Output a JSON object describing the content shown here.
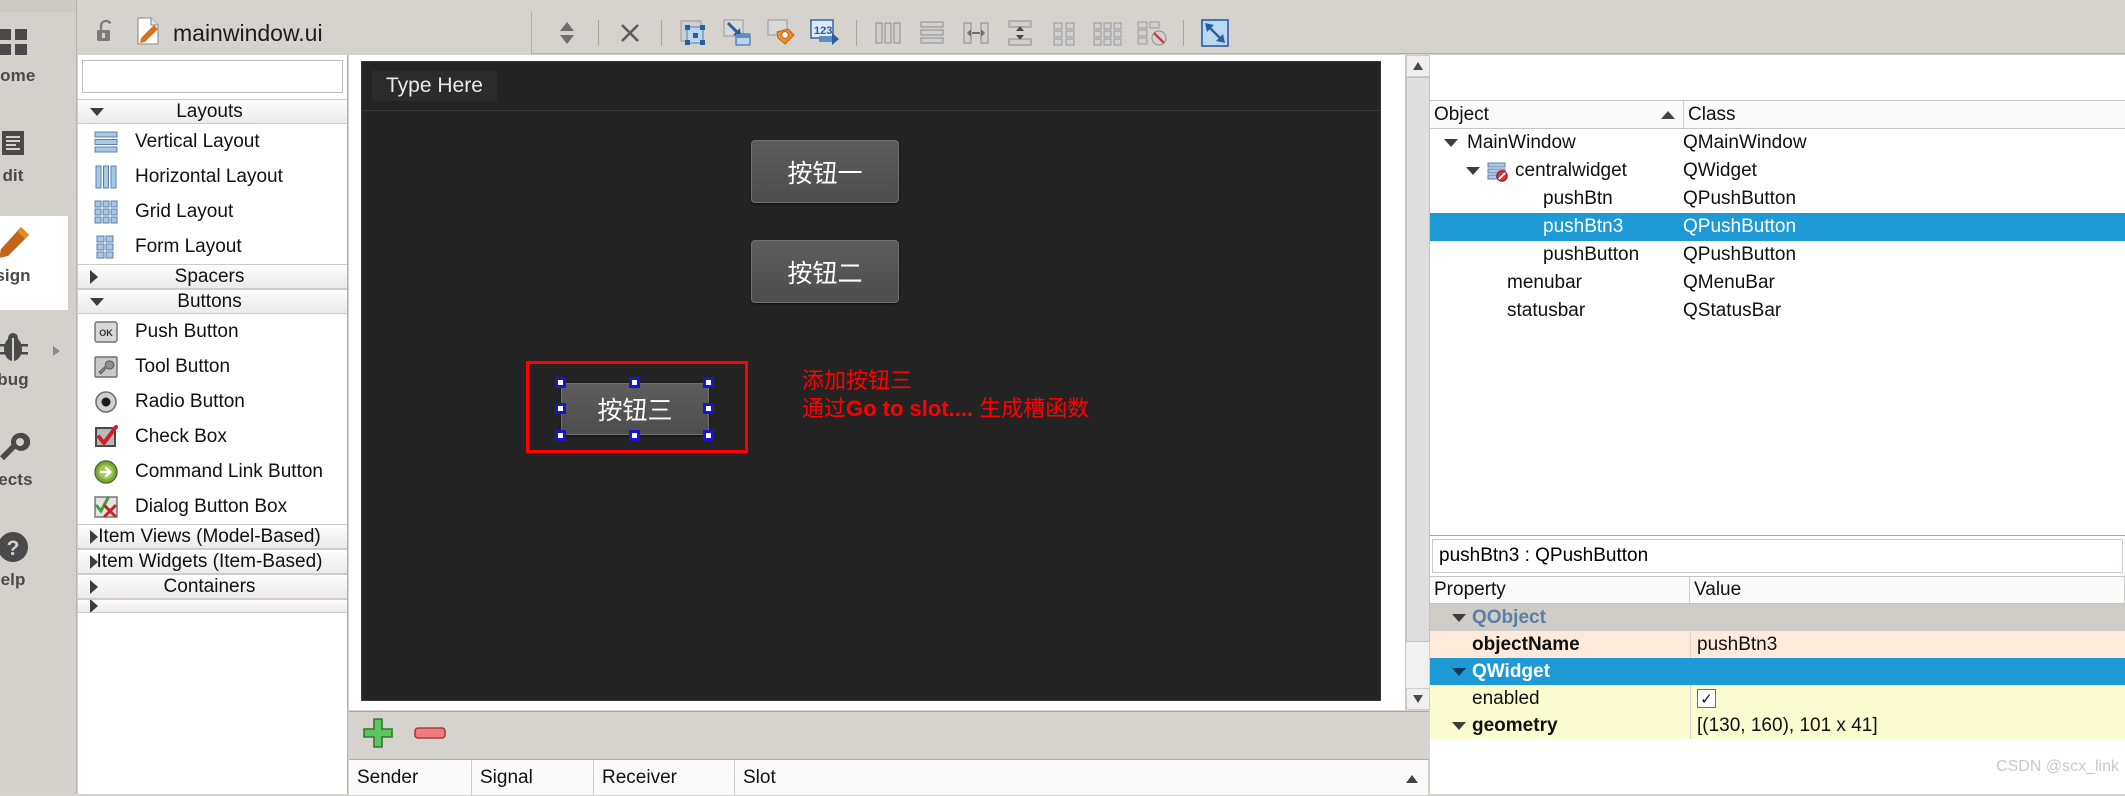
{
  "toolbar": {
    "file_name": "mainwindow.ui",
    "lock_icon": "unlock-icon",
    "file_icon": "ui-file-icon",
    "updown_icon": "updown-arrows-icon",
    "close_icon": "close-x-icon",
    "buttons": [
      {
        "name": "edit-widgets-icon",
        "tip": "Edit Widgets"
      },
      {
        "name": "edit-signals-slots-icon",
        "tip": "Edit Signals/Slots"
      },
      {
        "name": "edit-buddies-icon",
        "tip": "Edit Buddies"
      },
      {
        "name": "edit-tab-order-icon",
        "tip": "Edit Tab Order"
      },
      {
        "name": "layout-horizontally-icon",
        "tip": "Lay Out Horizontally"
      },
      {
        "name": "layout-vertically-icon",
        "tip": "Lay Out Vertically"
      },
      {
        "name": "layout-splitter-horizontal-icon",
        "tip": "Lay Out Horizontally in Splitter"
      },
      {
        "name": "layout-splitter-vertical-icon",
        "tip": "Lay Out Vertically in Splitter"
      },
      {
        "name": "layout-form-icon",
        "tip": "Lay Out in a Form Layout"
      },
      {
        "name": "layout-grid-icon",
        "tip": "Lay Out in a Grid"
      },
      {
        "name": "break-layout-icon",
        "tip": "Break Layout"
      },
      {
        "name": "adjust-size-icon",
        "tip": "Adjust Size"
      }
    ]
  },
  "mode_rail": {
    "items": [
      {
        "label": "come",
        "icon": "welcome-grid-icon",
        "active": false
      },
      {
        "label": "dit",
        "icon": "edit-document-icon",
        "active": false
      },
      {
        "label": "sign",
        "icon": "design-pencil-icon",
        "active": true
      },
      {
        "label": "bug",
        "icon": "debug-bug-icon",
        "active": false
      },
      {
        "label": "jects",
        "icon": "projects-wrench-icon",
        "active": false
      },
      {
        "label": "elp",
        "icon": "help-question-icon",
        "active": false
      }
    ]
  },
  "widget_box": {
    "filter_value": "",
    "sections": [
      {
        "label": "Layouts",
        "expanded": true,
        "items": [
          {
            "label": "Vertical Layout",
            "icon": "vertical-layout-icon"
          },
          {
            "label": "Horizontal Layout",
            "icon": "horizontal-layout-icon"
          },
          {
            "label": "Grid Layout",
            "icon": "grid-layout-icon"
          },
          {
            "label": "Form Layout",
            "icon": "form-layout-icon"
          }
        ]
      },
      {
        "label": "Spacers",
        "expanded": false,
        "items": []
      },
      {
        "label": "Buttons",
        "expanded": true,
        "items": [
          {
            "label": "Push Button",
            "icon": "push-button-icon"
          },
          {
            "label": "Tool Button",
            "icon": "tool-button-icon"
          },
          {
            "label": "Radio Button",
            "icon": "radio-button-icon"
          },
          {
            "label": "Check Box",
            "icon": "check-box-icon"
          },
          {
            "label": "Command Link Button",
            "icon": "command-link-button-icon"
          },
          {
            "label": "Dialog Button Box",
            "icon": "dialog-button-box-icon"
          }
        ]
      },
      {
        "label": "Item Views (Model-Based)",
        "expanded": false,
        "items": []
      },
      {
        "label": "Item Widgets (Item-Based)",
        "expanded": false,
        "items": []
      },
      {
        "label": "Containers",
        "expanded": false,
        "items": []
      }
    ]
  },
  "form": {
    "menu_placeholder": "Type Here",
    "buttons": [
      {
        "text": "按钮一",
        "selected": false
      },
      {
        "text": "按钮二",
        "selected": false
      },
      {
        "text": "按钮三",
        "selected": true
      }
    ],
    "annotation_line1": "添加按钮三",
    "annotation_line2_pre": "通过",
    "annotation_line2_bold": "Go to slot....",
    "annotation_line2_post": " 生成槽函数",
    "annotation_color": "#ff0000",
    "selection_color": "#ff0000",
    "handle_color": "#1515d8"
  },
  "signals_slots": {
    "add_icon": "add-plus-icon",
    "remove_icon": "remove-minus-icon",
    "columns": [
      "Sender",
      "Signal",
      "Receiver",
      "Slot"
    ]
  },
  "inspector": {
    "filter_value": "",
    "columns": [
      "Object",
      "Class"
    ],
    "sort_indicator": "sort-ascending-icon",
    "rows": [
      {
        "object": "MainWindow",
        "class": "QMainWindow",
        "depth": 0,
        "expander": "down",
        "icon": "",
        "selected": false
      },
      {
        "object": "centralwidget",
        "class": "QWidget",
        "depth": 1,
        "expander": "down",
        "icon": "central-widget-icon",
        "selected": false
      },
      {
        "object": "pushBtn",
        "class": "QPushButton",
        "depth": 2,
        "expander": "",
        "icon": "",
        "selected": false
      },
      {
        "object": "pushBtn3",
        "class": "QPushButton",
        "depth": 2,
        "expander": "",
        "icon": "",
        "selected": true
      },
      {
        "object": "pushButton",
        "class": "QPushButton",
        "depth": 2,
        "expander": "",
        "icon": "",
        "selected": false
      },
      {
        "object": "menubar",
        "class": "QMenuBar",
        "depth": 1,
        "expander": "",
        "icon": "",
        "selected": false
      },
      {
        "object": "statusbar",
        "class": "QStatusBar",
        "depth": 1,
        "expander": "",
        "icon": "",
        "selected": false
      }
    ]
  },
  "properties": {
    "object_header": "pushBtn3 : QPushButton",
    "columns": [
      "Property",
      "Value"
    ],
    "rows": [
      {
        "name": "QObject",
        "value": "",
        "kind": "group-gray",
        "expander": "down"
      },
      {
        "name": "objectName",
        "value": "pushBtn3",
        "kind": "peach",
        "expander": ""
      },
      {
        "name": "QWidget",
        "value": "",
        "kind": "group-blue",
        "expander": "down"
      },
      {
        "name": "enabled",
        "value": "",
        "kind": "lemon",
        "expander": "",
        "checkbox": true,
        "checked": true
      },
      {
        "name": "geometry",
        "value": "[(130, 160), 101 x 41]",
        "kind": "lemon-bold",
        "expander": "down"
      }
    ]
  },
  "watermark": "CSDN @scx_link",
  "colors": {
    "selection_blue": "#1e9bd7",
    "annotation_red": "#ff0000",
    "canvas_bg": "#232323",
    "chrome_bg": "#d6d2ce",
    "peach": "#fdeadb",
    "lemon": "#fbfbd0"
  }
}
